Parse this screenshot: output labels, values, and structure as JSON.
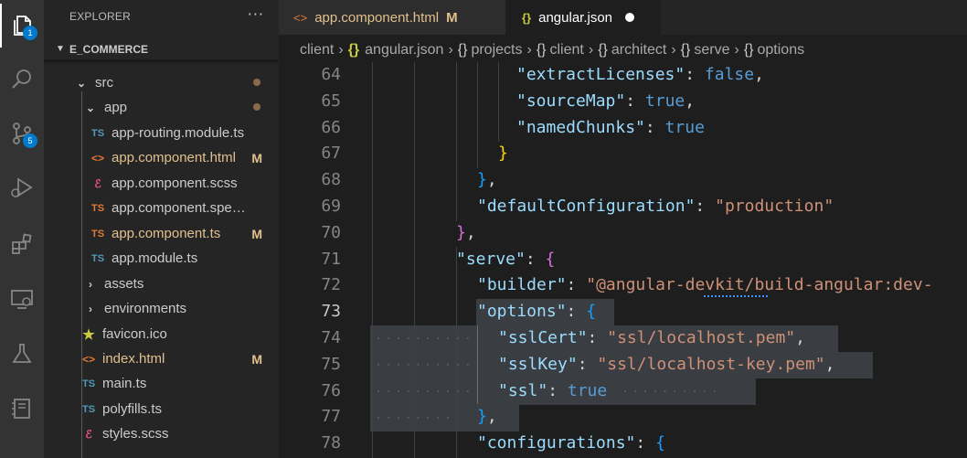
{
  "activity_bar": {
    "items": [
      {
        "icon": "files-icon",
        "badge": "1"
      },
      {
        "icon": "search-icon",
        "badge": ""
      },
      {
        "icon": "source-control-icon",
        "badge": "5"
      },
      {
        "icon": "run-debug-icon",
        "badge": ""
      },
      {
        "icon": "extensions-icon",
        "badge": ""
      },
      {
        "icon": "remote-explorer-icon",
        "badge": ""
      },
      {
        "icon": "testing-icon",
        "badge": ""
      },
      {
        "icon": "notebook-icon",
        "badge": ""
      }
    ]
  },
  "sidebar": {
    "title": "EXPLORER",
    "more": "···",
    "section": "E_COMMERCE",
    "tree": [
      {
        "label": "src",
        "kind": "folder-open",
        "status": "",
        "modified_dot": true
      },
      {
        "label": "app",
        "kind": "folder-open",
        "status": "",
        "modified_dot": true
      },
      {
        "label": "app-routing.module.ts",
        "kind": "ts",
        "status": ""
      },
      {
        "label": "app.component.html",
        "kind": "html",
        "status": "M"
      },
      {
        "label": "app.component.scss",
        "kind": "scss",
        "status": ""
      },
      {
        "label": "app.component.spec.ts",
        "kind": "spec",
        "status": ""
      },
      {
        "label": "app.component.ts",
        "kind": "ts-mod",
        "status": "M"
      },
      {
        "label": "app.module.ts",
        "kind": "ts",
        "status": ""
      },
      {
        "label": "assets",
        "kind": "folder",
        "status": ""
      },
      {
        "label": "environments",
        "kind": "folder",
        "status": ""
      },
      {
        "label": "favicon.ico",
        "kind": "star",
        "status": ""
      },
      {
        "label": "index.html",
        "kind": "html",
        "status": "M"
      },
      {
        "label": "main.ts",
        "kind": "ts",
        "status": ""
      },
      {
        "label": "polyfills.ts",
        "kind": "ts",
        "status": ""
      },
      {
        "label": "styles.scss",
        "kind": "scss",
        "status": ""
      }
    ]
  },
  "tabs": [
    {
      "label": "app.component.html",
      "icon": "<>",
      "mark": "M"
    },
    {
      "label": "angular.json",
      "icon": "{}",
      "mark": "●"
    }
  ],
  "breadcrumb": [
    "client",
    "angular.json",
    "projects",
    "client",
    "architect",
    "serve",
    "options"
  ],
  "editor": {
    "current_line": 73,
    "lines": [
      {
        "n": "64",
        "tokens": [
          [
            "k",
            "\"extractLicenses\""
          ],
          [
            "p",
            ": "
          ],
          [
            "b",
            "false"
          ],
          [
            "p",
            ","
          ]
        ]
      },
      {
        "n": "65",
        "tokens": [
          [
            "k",
            "\"sourceMap\""
          ],
          [
            "p",
            ": "
          ],
          [
            "b",
            "true"
          ],
          [
            "p",
            ","
          ]
        ]
      },
      {
        "n": "66",
        "tokens": [
          [
            "k",
            "\"namedChunks\""
          ],
          [
            "p",
            ": "
          ],
          [
            "b",
            "true"
          ]
        ]
      },
      {
        "n": "67",
        "tokens": [
          [
            "y",
            "}"
          ]
        ]
      },
      {
        "n": "68",
        "tokens": [
          [
            "bl",
            "}"
          ],
          [
            "p",
            ","
          ]
        ]
      },
      {
        "n": "69",
        "tokens": [
          [
            "k",
            "\"defaultConfiguration\""
          ],
          [
            "p",
            ": "
          ],
          [
            "s",
            "\"production\""
          ]
        ]
      },
      {
        "n": "70",
        "tokens": [
          [
            "m",
            "}"
          ],
          [
            "p",
            ","
          ]
        ]
      },
      {
        "n": "71",
        "tokens": [
          [
            "k",
            "\"serve\""
          ],
          [
            "p",
            ": "
          ],
          [
            "m",
            "{"
          ]
        ]
      },
      {
        "n": "72",
        "tokens": [
          [
            "k",
            "\"builder\""
          ],
          [
            "p",
            ": "
          ],
          [
            "s",
            "\"@angular-devkit/build-angular:dev-"
          ]
        ]
      },
      {
        "n": "73",
        "tokens": [
          [
            "k",
            "\"options\""
          ],
          [
            "p",
            ": "
          ],
          [
            "bl",
            "{"
          ]
        ]
      },
      {
        "n": "74",
        "tokens": [
          [
            "k",
            "\"sslCert\""
          ],
          [
            "p",
            ": "
          ],
          [
            "s",
            "\"ssl/localhost.pem\""
          ],
          [
            "p",
            ","
          ]
        ]
      },
      {
        "n": "75",
        "tokens": [
          [
            "k",
            "\"sslKey\""
          ],
          [
            "p",
            ": "
          ],
          [
            "s",
            "\"ssl/localhost-key.pem\""
          ],
          [
            "p",
            ","
          ]
        ]
      },
      {
        "n": "76",
        "tokens": [
          [
            "k",
            "\"ssl\""
          ],
          [
            "p",
            ": "
          ],
          [
            "b",
            "true"
          ]
        ]
      },
      {
        "n": "77",
        "tokens": [
          [
            "bl",
            "}"
          ],
          [
            "p",
            ","
          ]
        ]
      },
      {
        "n": "78",
        "tokens": [
          [
            "k",
            "\"configurations\""
          ],
          [
            "p",
            ": "
          ],
          [
            "bl",
            "{"
          ]
        ]
      }
    ]
  }
}
